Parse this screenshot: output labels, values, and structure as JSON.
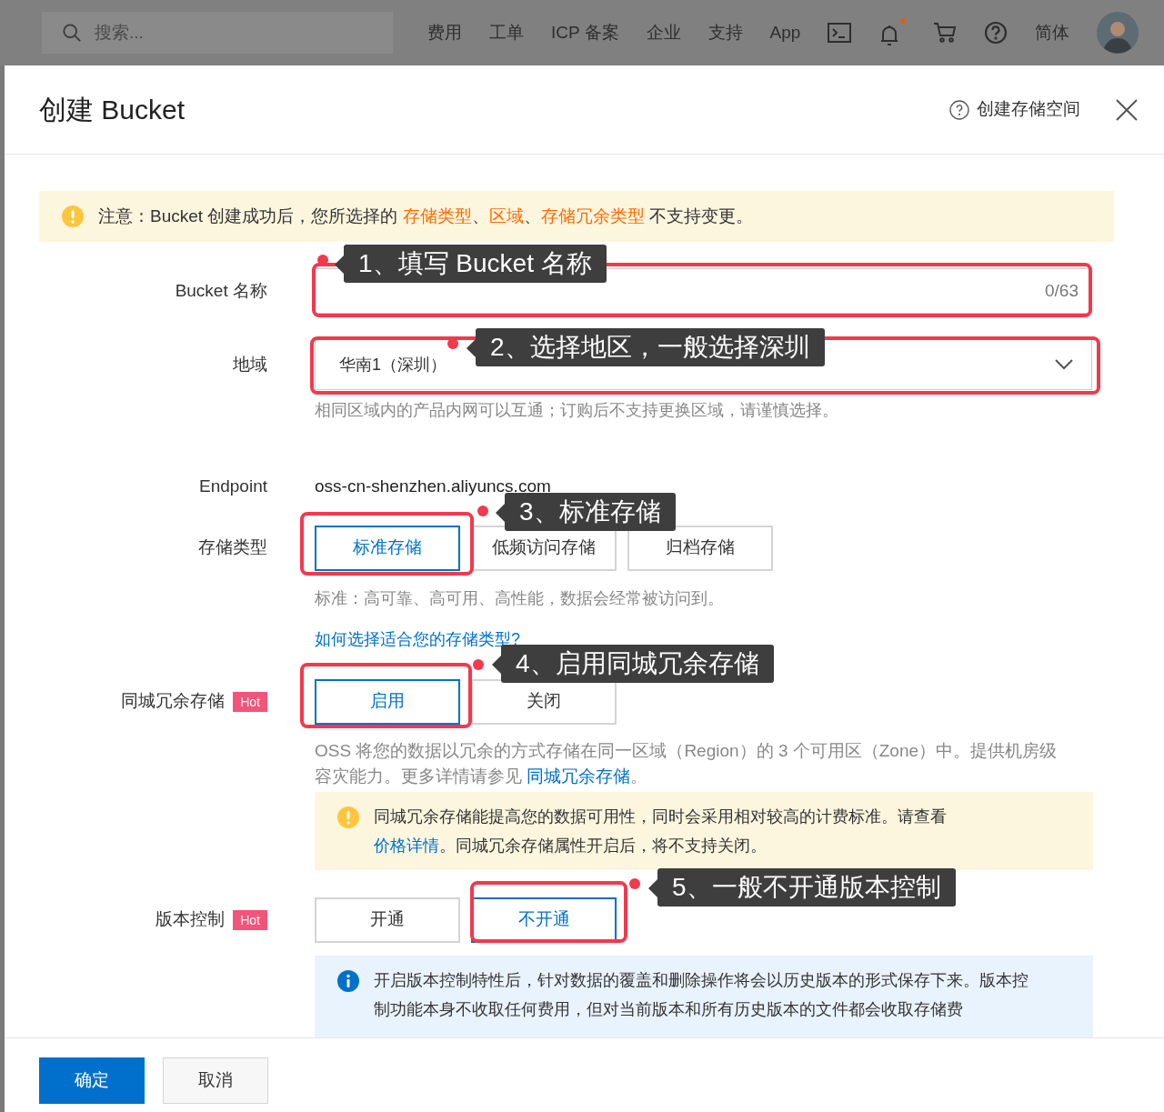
{
  "top_bar": {
    "search": {
      "placeholder": "搜索..."
    },
    "links": [
      "费用",
      "工单",
      "ICP 备案",
      "企业",
      "支持",
      "App"
    ],
    "has_notification": true,
    "language": "简体"
  },
  "drawer": {
    "title": "创建 Bucket",
    "help_link": "创建存储空间",
    "notice": [
      {
        "kind": "plain",
        "text": "注意：Bucket 创建成功后，您所选择的 "
      },
      {
        "kind": "highlight",
        "text": "存储类型"
      },
      {
        "kind": "plain",
        "text": "、"
      },
      {
        "kind": "highlight",
        "text": "区域"
      },
      {
        "kind": "plain",
        "text": "、"
      },
      {
        "kind": "highlight",
        "text": "存储冗余类型"
      },
      {
        "kind": "plain",
        "text": " 不支持变更。"
      }
    ],
    "bucket_name": {
      "label": "Bucket 名称",
      "counter": "0/63"
    },
    "region": {
      "label": "地域",
      "value": "华南1（深圳）",
      "hint": "相同区域内的产品内网可以互通；订购后不支持更换区域，请谨慎选择。"
    },
    "endpoint": {
      "label": "Endpoint",
      "value": "oss-cn-shenzhen.aliyuncs.com"
    },
    "storage_type": {
      "label": "存储类型",
      "options": [
        {
          "label": "标准存储",
          "selected": true
        },
        {
          "label": "低频访问存储",
          "selected": false
        },
        {
          "label": "归档存储",
          "selected": false
        }
      ],
      "hint": "标准：高可靠、高可用、高性能，数据会经常被访问到。",
      "link": "如何选择适合您的存储类型?"
    },
    "redundancy": {
      "label": "同城冗余存储",
      "badge": "Hot",
      "options": [
        {
          "label": "启用",
          "selected": true
        },
        {
          "label": "关闭",
          "selected": false
        }
      ],
      "description": [
        {
          "kind": "plain",
          "text": "OSS 将您的数据以冗余的方式存储在同一区域（Region）的 3 个可用区（Zone）中。提供机房级容灾能力。更多详情请参见 "
        },
        {
          "kind": "link",
          "text": "同城冗余存储"
        },
        {
          "kind": "plain",
          "text": "。"
        }
      ],
      "warning": [
        {
          "kind": "plain",
          "text": "同城冗余存储能提高您的数据可用性，同时会采用相对较高的计费标准。请查看 "
        },
        {
          "kind": "link",
          "text": "价格详情"
        },
        {
          "kind": "plain",
          "text": "。同城冗余存储属性开启后，将不支持关闭。"
        }
      ]
    },
    "versioning": {
      "label": "版本控制",
      "badge": "Hot",
      "options": [
        {
          "label": "开通",
          "selected": false
        },
        {
          "label": "不开通",
          "selected": true
        }
      ],
      "info": "开启版本控制特性后，针对数据的覆盖和删除操作将会以历史版本的形式保存下来。版本控制功能本身不收取任何费用，但对当前版本和所有历史版本的文件都会收取存储费"
    },
    "footer": {
      "confirm": "确定",
      "cancel": "取消"
    }
  },
  "annotations": [
    {
      "text": "1、填写 Bucket 名称"
    },
    {
      "text": "2、选择地区，一般选择深圳"
    },
    {
      "text": "3、标准存储"
    },
    {
      "text": "4、启用同城冗余存储"
    },
    {
      "text": "5、一般不开通版本控制"
    }
  ]
}
